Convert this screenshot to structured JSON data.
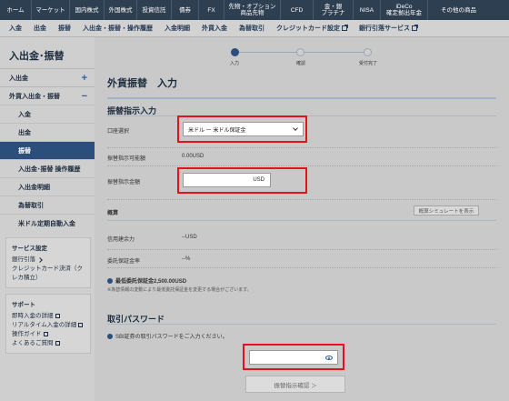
{
  "topnav": {
    "items": [
      {
        "l1": "ホーム",
        "l2": ""
      },
      {
        "l1": "マーケット",
        "l2": ""
      },
      {
        "l1": "国内株式",
        "l2": ""
      },
      {
        "l1": "外国株式",
        "l2": ""
      },
      {
        "l1": "投資信託",
        "l2": ""
      },
      {
        "l1": "債券",
        "l2": ""
      },
      {
        "l1": "FX",
        "l2": ""
      },
      {
        "l1": "先物・オプション",
        "l2": "商品先物"
      },
      {
        "l1": "CFD",
        "l2": ""
      },
      {
        "l1": "金・銀",
        "l2": "プラチナ"
      },
      {
        "l1": "NISA",
        "l2": ""
      },
      {
        "l1": "iDeCo",
        "l2": "確定拠出年金"
      },
      {
        "l1": "その他の商品",
        "l2": ""
      }
    ]
  },
  "subnav": {
    "items": [
      "入金",
      "出金",
      "振替",
      "入出金・振替・操作履歴",
      "入金明細",
      "外貨入金",
      "為替取引",
      "クレジットカード設定",
      "銀行引落サービス"
    ]
  },
  "sidebar": {
    "title": "入出金･振替",
    "sections": [
      {
        "label": "入出金",
        "toggle": "+"
      },
      {
        "label": "外貨入出金・振替",
        "toggle": "−"
      }
    ],
    "items": [
      "入金",
      "出金",
      "振替",
      "入出金･振替 操作履歴",
      "入出金明細",
      "為替取引",
      "米ドル定期自動入金"
    ],
    "service_box": {
      "title": "サービス設定",
      "links": [
        "銀行引落",
        "クレジットカード決済（クレカ積立）"
      ]
    },
    "support_box": {
      "title": "サポート",
      "links": [
        "即時入金の詳細",
        "リアルタイム入金の詳細",
        "操作ガイド",
        "よくあるご質問"
      ]
    }
  },
  "stepper": {
    "steps": [
      "入力",
      "確認",
      "受付完了"
    ]
  },
  "main": {
    "title": "外貨振替　入力",
    "section1": "振替指示入力",
    "account_label": "口座選択",
    "account_value": "米ドル ー 米ドル保証金",
    "available_label": "振替指示可能額",
    "available_value": "0.00USD",
    "amount_label": "振替指示金額",
    "amount_unit": "USD",
    "summary_label": "概算",
    "simulate_btn": "概算シミュレートを表示",
    "credit_label": "信用建余力",
    "credit_value": "--USD",
    "margin_label": "委託保証金率",
    "margin_value": "--%",
    "min_margin": "最低委託保証金2,500.00USD",
    "min_note": "※為替情報の変動により最低委託保証金を変更する場合がございます。",
    "section2": "取引パスワード",
    "pw_prompt": "SBI証券の取引パスワードをご入力ください。",
    "confirm_btn": "振替指示確認 ＞"
  }
}
